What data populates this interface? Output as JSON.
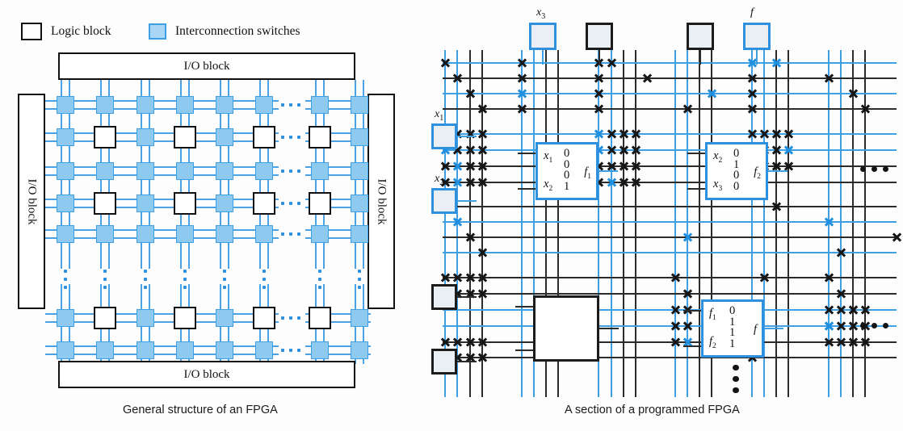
{
  "figure": {
    "left_caption": "General structure of an FPGA",
    "right_caption": "A section of a programmed FPGA"
  },
  "legend": {
    "items": [
      {
        "key": "logic-block",
        "label": "Logic block",
        "swatch": "outlined-square",
        "color": "#ffffff",
        "border": "#111111"
      },
      {
        "key": "interconnection-switches",
        "label": "Interconnection switches",
        "swatch": "filled-square",
        "color": "#8ec9f0",
        "border": "#3f9fe4"
      }
    ]
  },
  "left_diagram": {
    "io_blocks": [
      {
        "id": "io-top",
        "label": "I/O block",
        "orientation": "horizontal"
      },
      {
        "id": "io-left",
        "label": "I/O block",
        "orientation": "vertical"
      },
      {
        "id": "io-right",
        "label": "I/O block",
        "orientation": "vertical"
      },
      {
        "id": "io-bottom",
        "label": "I/O block",
        "orientation": "horizontal"
      }
    ],
    "grid": {
      "switch_columns": 8,
      "logic_rows": 3,
      "switch_rows": 5,
      "ellipsis_horizontal_count": 6,
      "ellipsis_vertical_count": 6
    },
    "colors": {
      "wire": "#49a3e6",
      "switch_fill": "#8ec9f0",
      "switch_border": "#3f9fe4",
      "logic_border": "#111111"
    }
  },
  "right_diagram": {
    "pads": [
      {
        "id": "pad-x3",
        "label": "x",
        "sub": "3",
        "style": "blue",
        "position": "top"
      },
      {
        "id": "pad-top-unlabeled-1",
        "label": "",
        "sub": "",
        "style": "black",
        "position": "top"
      },
      {
        "id": "pad-top-unlabeled-2",
        "label": "",
        "sub": "",
        "style": "black",
        "position": "top"
      },
      {
        "id": "pad-f",
        "label": "f",
        "sub": "",
        "style": "blue",
        "position": "top"
      },
      {
        "id": "pad-x1",
        "label": "x",
        "sub": "1",
        "style": "blue",
        "position": "left"
      },
      {
        "id": "pad-x2",
        "label": "x",
        "sub": "2",
        "style": "blue",
        "position": "left"
      },
      {
        "id": "pad-left-unlabeled-1",
        "label": "",
        "sub": "",
        "style": "black",
        "position": "left"
      },
      {
        "id": "pad-left-unlabeled-2",
        "label": "",
        "sub": "",
        "style": "black",
        "position": "left"
      }
    ],
    "luts": [
      {
        "id": "lut-f1",
        "inputs": [
          "x₁",
          "x₂"
        ],
        "input_a": "x",
        "input_a_sub": "1",
        "input_b": "x",
        "input_b_sub": "2",
        "truth_table": [
          "0",
          "0",
          "0",
          "1"
        ],
        "output": "f",
        "output_sub": "1",
        "style": "blue"
      },
      {
        "id": "lut-f2",
        "inputs": [
          "x₂",
          "x₃"
        ],
        "input_a": "x",
        "input_a_sub": "2",
        "input_b": "x",
        "input_b_sub": "3",
        "truth_table": [
          "0",
          "1",
          "0",
          "0"
        ],
        "output": "f",
        "output_sub": "2",
        "style": "blue"
      },
      {
        "id": "lut-f",
        "inputs": [
          "f₁",
          "f₂"
        ],
        "input_a": "f",
        "input_a_sub": "1",
        "input_b": "f",
        "input_b_sub": "2",
        "truth_table": [
          "0",
          "1",
          "1",
          "1"
        ],
        "output": "f",
        "output_sub": "",
        "style": "blue"
      },
      {
        "id": "lut-unprogrammed",
        "inputs": [],
        "input_a": "",
        "input_a_sub": "",
        "input_b": "",
        "input_b_sub": "",
        "truth_table": [],
        "output": "",
        "output_sub": "",
        "style": "black"
      }
    ],
    "colors": {
      "routing_black": "#2b2b2b",
      "routing_blue": "#3f9fe4",
      "cross_black": "#161616",
      "cross_blue": "#1f8fe0"
    },
    "continuation_markers": {
      "horizontal": 3,
      "vertical": 3
    }
  }
}
